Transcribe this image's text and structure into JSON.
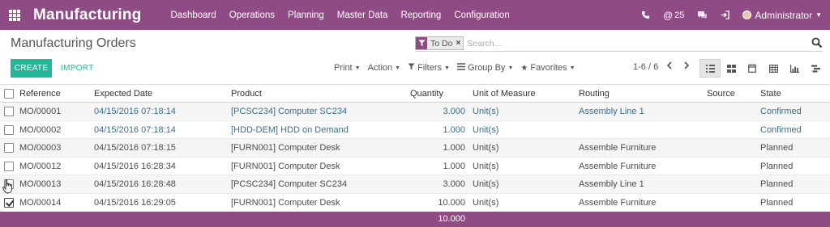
{
  "navbar": {
    "brand": "Manufacturing",
    "menu": [
      "Dashboard",
      "Operations",
      "Planning",
      "Master Data",
      "Reporting",
      "Configuration"
    ],
    "message_count": "25",
    "user": "Administrator"
  },
  "control": {
    "title": "Manufacturing Orders",
    "facet_label": "To Do",
    "search_placeholder": "Search...",
    "create_label": "CREATE",
    "import_label": "IMPORT",
    "print_label": "Print",
    "action_label": "Action",
    "filters_label": "Filters",
    "groupby_label": "Group By",
    "favorites_label": "Favorites",
    "pager": "1-6 / 6"
  },
  "table": {
    "headers": {
      "reference": "Reference",
      "date": "Expected Date",
      "product": "Product",
      "quantity": "Quantity",
      "uom": "Unit of Measure",
      "routing": "Routing",
      "source": "Source",
      "state": "State"
    },
    "rows": [
      {
        "reference": "MO/00001",
        "date": "04/15/2016 07:18:14",
        "product": "[PCSC234] Computer SC234",
        "quantity": "3.000",
        "uom": "Unit(s)",
        "routing": "Assembly Line 1",
        "source": "",
        "state": "Confirmed",
        "checked": false
      },
      {
        "reference": "MO/00002",
        "date": "04/15/2016 07:18:14",
        "product": "[HDD-DEM] HDD on Demand",
        "quantity": "1.000",
        "uom": "Unit(s)",
        "routing": "",
        "source": "",
        "state": "Confirmed",
        "checked": false
      },
      {
        "reference": "MO/00003",
        "date": "04/15/2016 07:18:15",
        "product": "[FURN001] Computer Desk",
        "quantity": "1.000",
        "uom": "Unit(s)",
        "routing": "Assemble Furniture",
        "source": "",
        "state": "Planned",
        "checked": false
      },
      {
        "reference": "MO/00012",
        "date": "04/15/2016 16:28:34",
        "product": "[FURN001] Computer Desk",
        "quantity": "1.000",
        "uom": "Unit(s)",
        "routing": "Assemble Furniture",
        "source": "",
        "state": "Planned",
        "checked": false
      },
      {
        "reference": "MO/00013",
        "date": "04/15/2016 16:28:48",
        "product": "[PCSC234] Computer SC234",
        "quantity": "3.000",
        "uom": "Unit(s)",
        "routing": "Assembly Line 1",
        "source": "",
        "state": "Planned",
        "checked": false
      },
      {
        "reference": "MO/00014",
        "date": "04/15/2016 16:29:05",
        "product": "[FURN001] Computer Desk",
        "quantity": "10.000",
        "uom": "Unit(s)",
        "routing": "Assemble Furniture",
        "source": "",
        "state": "Planned",
        "checked": true
      }
    ],
    "total_quantity": "10.000"
  },
  "colors": {
    "brand": "#8f4b83",
    "primary_button": "#21b799",
    "link": "#3c6d87"
  }
}
